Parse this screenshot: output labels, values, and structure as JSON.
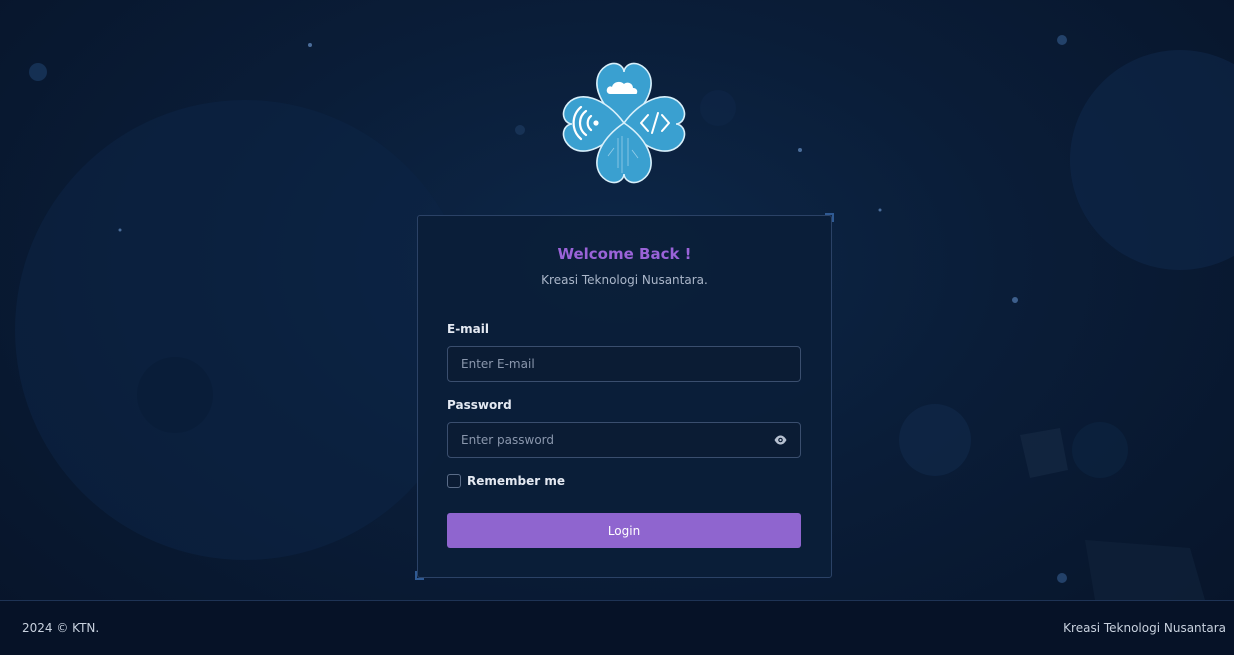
{
  "brand": {
    "logo_icons": [
      "cloud-icon",
      "wifi-icon",
      "code-icon",
      "circuit-icon"
    ],
    "colors": {
      "accent": "#8f65cf",
      "title": "#9a63d8",
      "logo": "#3aa0d0",
      "background": "#0a1d38"
    }
  },
  "login": {
    "title": "Welcome Back !",
    "subtitle": "Kreasi Teknologi Nusantara.",
    "email_label": "E-mail",
    "email_placeholder": "Enter E-mail",
    "email_value": "",
    "password_label": "Password",
    "password_placeholder": "Enter password",
    "password_value": "",
    "remember_label": "Remember me",
    "remember_checked": false,
    "login_label": "Login"
  },
  "footer": {
    "copyright": "2024 © KTN.",
    "company": "Kreasi Teknologi Nusantara"
  }
}
